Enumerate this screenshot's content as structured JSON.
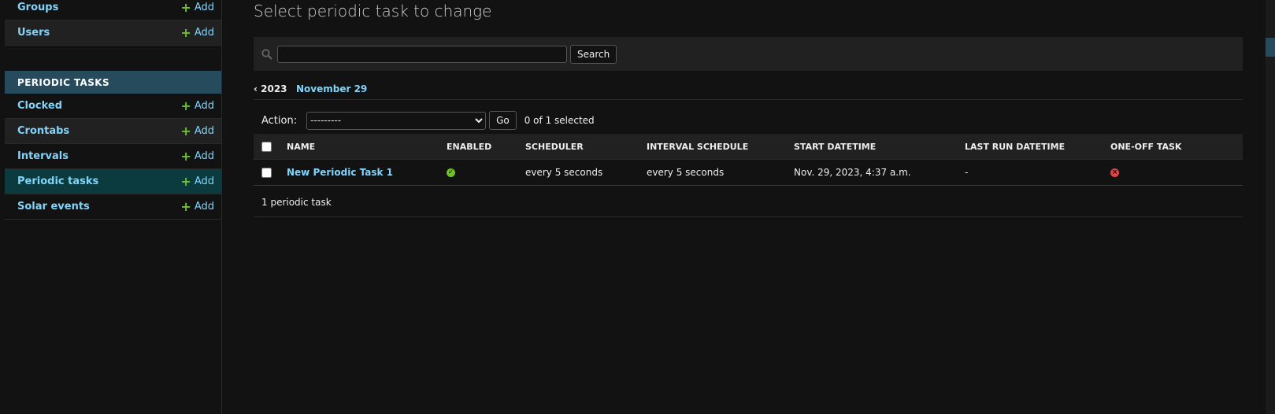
{
  "sidebar": {
    "top_items": [
      {
        "label": "Groups",
        "add": "Add"
      },
      {
        "label": "Users",
        "add": "Add"
      }
    ],
    "section_caption": "PERIODIC TASKS",
    "items": [
      {
        "label": "Clocked",
        "add": "Add"
      },
      {
        "label": "Crontabs",
        "add": "Add"
      },
      {
        "label": "Intervals",
        "add": "Add"
      },
      {
        "label": "Periodic tasks",
        "add": "Add"
      },
      {
        "label": "Solar events",
        "add": "Add"
      }
    ],
    "current_item": "Periodic tasks"
  },
  "page": {
    "title": "Select periodic task to change"
  },
  "toolbar": {
    "search_label": "Search",
    "search_value": ""
  },
  "date_hierarchy": {
    "back": "‹ 2023",
    "current": "November 29"
  },
  "actions": {
    "label": "Action:",
    "selected_option": "---------",
    "go": "Go",
    "selection_count": "0 of 1 selected"
  },
  "table": {
    "columns": [
      "NAME",
      "ENABLED",
      "SCHEDULER",
      "INTERVAL SCHEDULE",
      "START DATETIME",
      "LAST RUN DATETIME",
      "ONE-OFF TASK"
    ],
    "rows": [
      {
        "name": "New Periodic Task 1",
        "enabled": true,
        "scheduler": "every 5 seconds",
        "interval_schedule": "every 5 seconds",
        "start_datetime": "Nov. 29, 2023, 4:37 a.m.",
        "last_run_datetime": "-",
        "one_off_task": false
      }
    ]
  },
  "paginator": "1 periodic task",
  "colors": {
    "background": "#121212",
    "link": "#81d4fa",
    "accent": "#264b5d",
    "current_row": "#0b3b3f",
    "add_plus": "#70bf2b",
    "yes": "#70bf2b",
    "no": "#dd4646"
  }
}
